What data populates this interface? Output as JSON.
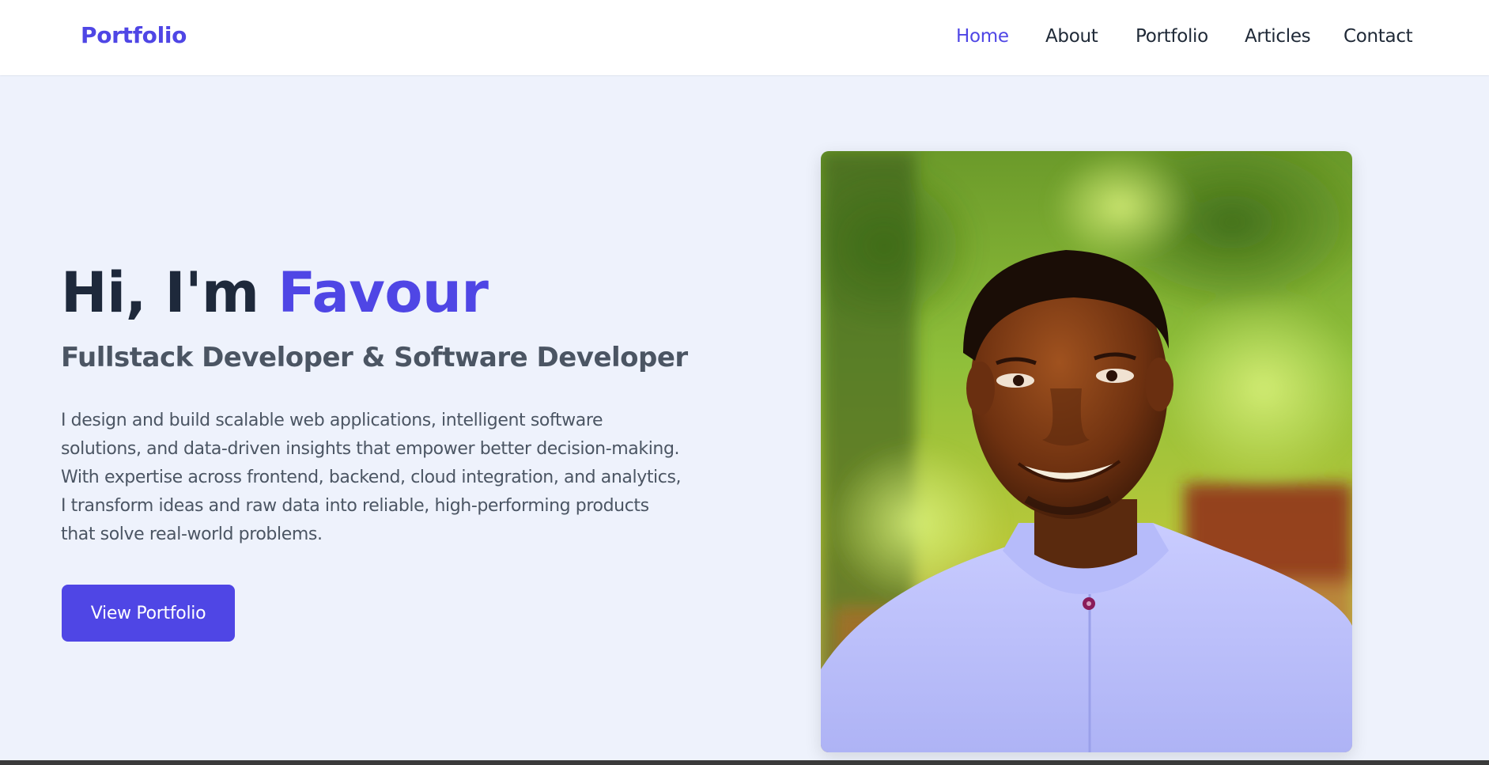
{
  "navbar": {
    "brand": "Portfolio",
    "links": [
      {
        "label": "Home",
        "active": true
      },
      {
        "label": "About",
        "active": false
      },
      {
        "label": "Portfolio",
        "active": false
      },
      {
        "label": "Articles",
        "active": false
      },
      {
        "label": "Contact",
        "active": false
      }
    ]
  },
  "hero": {
    "greeting": "Hi, I'm ",
    "name": "Favour",
    "subtitle": "Fullstack Developer & Software Developer",
    "description": "I design and build scalable web applications, intelligent software solutions, and data-driven insights that empower better decision-making. With expertise across frontend, backend, cloud integration, and analytics, I transform ideas and raw data into reliable, high-performing products that solve real-world problems.",
    "cta_label": "View Portfolio"
  },
  "colors": {
    "accent": "#4f46e5",
    "heading": "#1e293b",
    "body_text": "#4b5563",
    "background": "#eef2fc"
  },
  "icons": {
    "profile_photo": "profile-photo"
  }
}
